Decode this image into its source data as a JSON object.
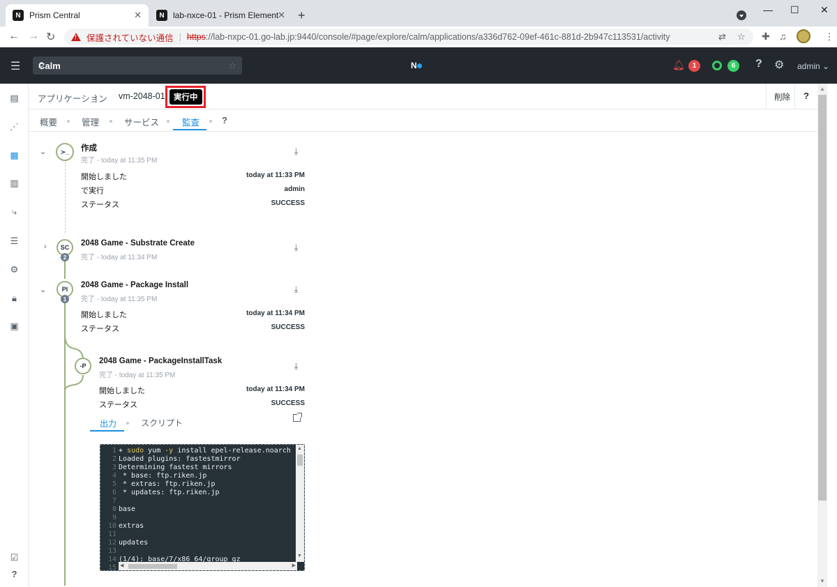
{
  "browser": {
    "tabs": [
      {
        "label": "Prism Central",
        "favicon": "N"
      },
      {
        "label": "lab-nxce-01 - Prism Element",
        "favicon": "N"
      }
    ],
    "warning_text": "保護されていない通信",
    "url_scheme": "https",
    "url_rest": "://lab-nxpc-01.go-lab.jp:9440/console/#page/explore/calm/applications/a336d762-09ef-461c-881d-2b947c113531/activity"
  },
  "header": {
    "search_value": "Calm",
    "logo_text": "N",
    "alert_count": "1",
    "task_count": "6",
    "user": "admin"
  },
  "breadcrumb": {
    "parent": "アプリケーション",
    "app_name": "vm-2048-01",
    "status": "実行中",
    "delete": "削除",
    "help": "?"
  },
  "subtabs": [
    "概要",
    "管理",
    "サービス",
    "監査",
    "?"
  ],
  "timeline": {
    "create": {
      "node": "≻_",
      "title": "作成",
      "status": "完了",
      "time": "today at 11:35 PM",
      "rows": [
        {
          "label": "開始しました",
          "value": "today at 11:33 PM"
        },
        {
          "label": "で実行",
          "value": "admin"
        },
        {
          "label": "ステータス",
          "value": "SUCCESS"
        }
      ]
    },
    "substrate": {
      "node": "SC",
      "badge": "2",
      "title": "2048 Game - Substrate Create",
      "status": "完了",
      "time": "today at 11:34 PM"
    },
    "package": {
      "node": "PI",
      "badge": "1",
      "title": "2048 Game - Package Install",
      "status": "完了",
      "time": "today at 11:35 PM",
      "rows": [
        {
          "label": "開始しました",
          "value": "today at 11:34 PM"
        },
        {
          "label": "ステータス",
          "value": "SUCCESS"
        }
      ]
    },
    "task": {
      "node": "-P",
      "title": "2048 Game - PackageInstallTask",
      "status": "完了",
      "time": "today at 11:35 PM",
      "rows": [
        {
          "label": "開始しました",
          "value": "today at 11:34 PM"
        },
        {
          "label": "ステータス",
          "value": "SUCCESS"
        }
      ],
      "output_tabs": [
        "出力",
        "スクリプト"
      ]
    }
  },
  "terminal": {
    "lines": [
      {
        "n": "1",
        "pre": "+ ",
        "kw": "sudo",
        "mid": " yum ",
        "kw2": "-y",
        "post": " install epel-release.noarch"
      },
      {
        "n": "2",
        "pre": "Loaded plugins: fastestmirror"
      },
      {
        "n": "3",
        "pre": "Determining fastest mirrors"
      },
      {
        "n": "4",
        "pre": " * base: ftp.riken.jp"
      },
      {
        "n": "5",
        "pre": " * extras: ftp.riken.jp"
      },
      {
        "n": "6",
        "pre": " * updates: ftp.riken.jp"
      },
      {
        "n": "7",
        "pre": ""
      },
      {
        "n": "8",
        "pre": "base"
      },
      {
        "n": "9",
        "pre": ""
      },
      {
        "n": "10",
        "pre": "extras"
      },
      {
        "n": "11",
        "pre": ""
      },
      {
        "n": "12",
        "pre": "updates"
      },
      {
        "n": "13",
        "pre": ""
      },
      {
        "n": "14",
        "pre": "(1/4): base/7/x86_64/group_gz"
      },
      {
        "n": "15",
        "pre": ""
      }
    ]
  },
  "colors": {
    "accent": "#1b8fe0",
    "timeline": "#9ab17e",
    "alert": "#e64a4a",
    "ok": "#36d068",
    "highlight": "#e8202a"
  }
}
